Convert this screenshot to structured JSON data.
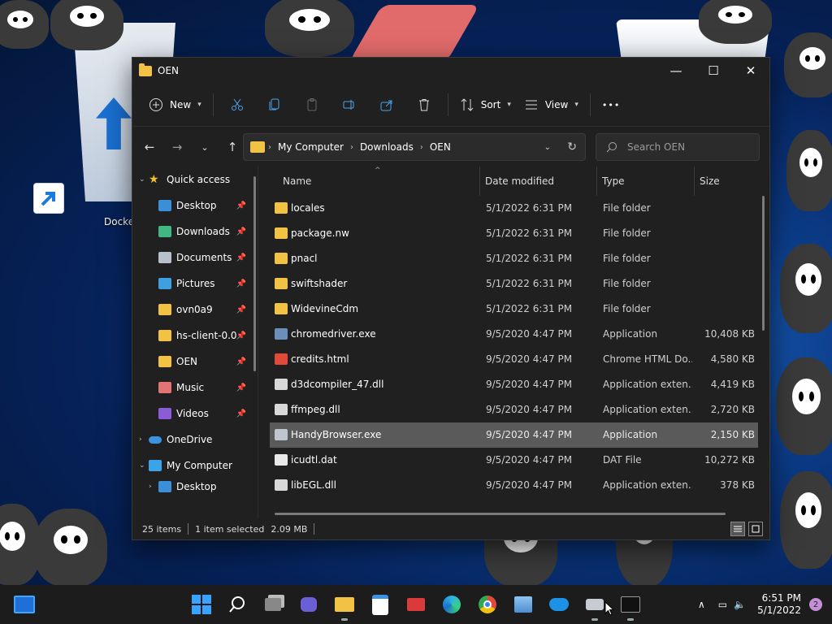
{
  "window": {
    "title": "OEN",
    "controls": {
      "minimize": "—",
      "maximize": "☐",
      "close": "✕"
    }
  },
  "commandbar": {
    "new_label": "New",
    "sort_label": "Sort",
    "view_label": "View",
    "more_label": "•••"
  },
  "address": {
    "crumbs": [
      "My Computer",
      "Downloads",
      "OEN"
    ],
    "search_placeholder": "Search OEN"
  },
  "nav": {
    "quick_access": "Quick access",
    "items": [
      {
        "label": "Desktop",
        "icon": "desktop-icon",
        "color": "#3b8fd8"
      },
      {
        "label": "Downloads",
        "icon": "download-icon",
        "color": "#41b883"
      },
      {
        "label": "Documents",
        "icon": "document-icon",
        "color": "#b8c0cc"
      },
      {
        "label": "Pictures",
        "icon": "pictures-icon",
        "color": "#3fa0e0"
      },
      {
        "label": "ovn0a9",
        "icon": "folder-icon",
        "color": "#f1c243"
      },
      {
        "label": "hs-client-0.0",
        "icon": "folder-icon",
        "color": "#f1c243"
      },
      {
        "label": "OEN",
        "icon": "folder-icon",
        "color": "#f1c243"
      },
      {
        "label": "Music",
        "icon": "music-icon",
        "color": "#e27474"
      },
      {
        "label": "Videos",
        "icon": "videos-icon",
        "color": "#8a5cd6"
      }
    ],
    "onedrive": "OneDrive",
    "my_computer": "My Computer",
    "sub_desktop": "Desktop"
  },
  "columns": {
    "name": "Name",
    "date": "Date modified",
    "type": "Type",
    "size": "Size"
  },
  "files": [
    {
      "name": "locales",
      "date": "5/1/2022 6:31 PM",
      "type": "File folder",
      "size": "",
      "icon": "folder-icon",
      "color": "#f1c243"
    },
    {
      "name": "package.nw",
      "date": "5/1/2022 6:31 PM",
      "type": "File folder",
      "size": "",
      "icon": "folder-icon",
      "color": "#f1c243"
    },
    {
      "name": "pnacl",
      "date": "5/1/2022 6:31 PM",
      "type": "File folder",
      "size": "",
      "icon": "folder-icon",
      "color": "#f1c243"
    },
    {
      "name": "swiftshader",
      "date": "5/1/2022 6:31 PM",
      "type": "File folder",
      "size": "",
      "icon": "folder-icon",
      "color": "#f1c243"
    },
    {
      "name": "WidevineCdm",
      "date": "5/1/2022 6:31 PM",
      "type": "File folder",
      "size": "",
      "icon": "folder-icon",
      "color": "#f1c243"
    },
    {
      "name": "chromedriver.exe",
      "date": "9/5/2020 4:47 PM",
      "type": "Application",
      "size": "10,408 KB",
      "icon": "exe-icon",
      "color": "#6b8fb8"
    },
    {
      "name": "credits.html",
      "date": "9/5/2020 4:47 PM",
      "type": "Chrome HTML Do...",
      "size": "4,580 KB",
      "icon": "chrome-icon",
      "color": "#e04a3a"
    },
    {
      "name": "d3dcompiler_47.dll",
      "date": "9/5/2020 4:47 PM",
      "type": "Application exten...",
      "size": "4,419 KB",
      "icon": "dll-icon",
      "color": "#d8d8d8"
    },
    {
      "name": "ffmpeg.dll",
      "date": "9/5/2020 4:47 PM",
      "type": "Application exten...",
      "size": "2,720 KB",
      "icon": "dll-icon",
      "color": "#d8d8d8"
    },
    {
      "name": "HandyBrowser.exe",
      "date": "9/5/2020 4:47 PM",
      "type": "Application",
      "size": "2,150 KB",
      "icon": "exe-icon",
      "color": "#bfc6cf",
      "selected": true
    },
    {
      "name": "icudtl.dat",
      "date": "9/5/2020 4:47 PM",
      "type": "DAT File",
      "size": "10,272 KB",
      "icon": "file-icon",
      "color": "#e8e8e8"
    },
    {
      "name": "libEGL.dll",
      "date": "9/5/2020 4:47 PM",
      "type": "Application exten...",
      "size": "378 KB",
      "icon": "dll-icon",
      "color": "#d8d8d8"
    }
  ],
  "status": {
    "count": "25 items",
    "selected": "1 item selected",
    "size": "2.09 MB"
  },
  "desktop": {
    "shortcut_label": "Docke"
  },
  "taskbar": {
    "time": "6:51 PM",
    "date": "5/1/2022",
    "notifications": "2"
  }
}
